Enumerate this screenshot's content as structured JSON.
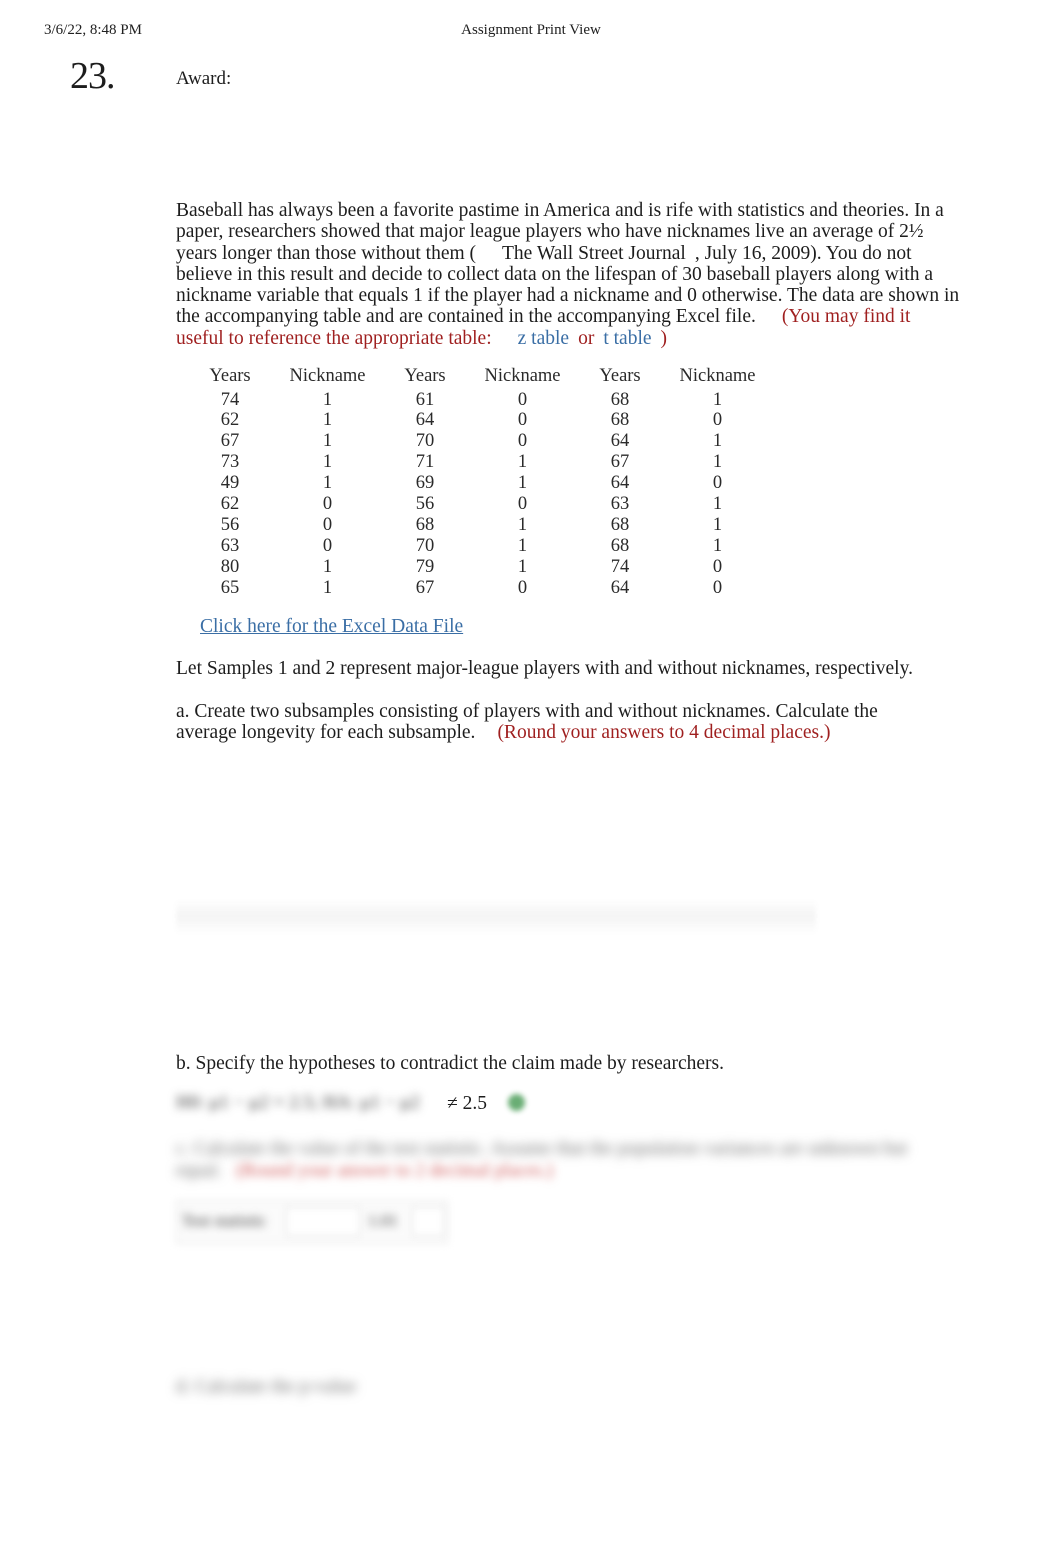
{
  "header": {
    "date": "3/6/22, 8:48 PM",
    "title": "Assignment Print View"
  },
  "question": {
    "number": "23.",
    "award_label": "Award:"
  },
  "stem": {
    "line1": "Baseball has always been a favorite pastime in America and is rife with statistics and theories. In a",
    "line2a": "paper, researchers showed that major league players who have nicknames live an average of 2½",
    "line3a": "years longer than those without them (",
    "source": "The Wall Street Journal",
    "line3b": ", July 16, 2009). You do not believe in",
    "line4": "this result and decide to collect data on the lifespan of 30 baseball players along with a nickname",
    "line5": "variable that equals 1 if the player had a nickname and 0 otherwise. The data are shown in the",
    "line6a": "accompanying table and are contained in the accompanying Excel file.",
    "line6b": "(You may find it useful to",
    "line7a": "reference the appropriate table:",
    "z_table": "z table",
    "or": "or",
    "t_table": "t table",
    "paren_close": ")"
  },
  "table": {
    "headers": [
      "Years",
      "Nickname",
      "Years",
      "Nickname",
      "Years",
      "Nickname"
    ],
    "rows": [
      [
        "74",
        "1",
        "61",
        "0",
        "68",
        "1"
      ],
      [
        "62",
        "1",
        "64",
        "0",
        "68",
        "0"
      ],
      [
        "67",
        "1",
        "70",
        "0",
        "64",
        "1"
      ],
      [
        "73",
        "1",
        "71",
        "1",
        "67",
        "1"
      ],
      [
        "49",
        "1",
        "69",
        "1",
        "64",
        "0"
      ],
      [
        "62",
        "0",
        "56",
        "0",
        "63",
        "1"
      ],
      [
        "56",
        "0",
        "68",
        "1",
        "68",
        "1"
      ],
      [
        "63",
        "0",
        "70",
        "1",
        "68",
        "1"
      ],
      [
        "80",
        "1",
        "79",
        "1",
        "74",
        "0"
      ],
      [
        "65",
        "1",
        "67",
        "0",
        "64",
        "0"
      ]
    ]
  },
  "excel_link": "Click here for the Excel Data File",
  "let_samples": "Let Samples 1 and 2 represent major-league players with and without nicknames, respectively.",
  "part_a": {
    "text_a": "a.  Create two subsamples consisting of players with and without nicknames. Calculate the average",
    "text_b": "longevity for each subsample.",
    "rounding": "(Round your answers to 4 decimal places.)"
  },
  "part_b": {
    "text": "b.  Specify the hypotheses to contradict the claim made by researchers.",
    "answer": "≠ 2.5"
  },
  "obscured": {
    "hypothesis_left": "H0: μ1 − μ2 = 2.5; HA: μ1 − μ2",
    "part_c_line1": "c.  Calculate the value of the test statistic. Assume that the population variances are unknown but",
    "part_c_line2": "equal.",
    "part_c_round": "(Round your answer to 2 decimal places.)",
    "stat_label": "Test statistic",
    "stat_value": "1.01",
    "part_d_line": "d.  Calculate the p-value."
  },
  "colors": {
    "red": "#9f1f1f",
    "link_blue": "#3a6ea5",
    "text": "#1d1d1d",
    "green": "#4f9f5c"
  }
}
